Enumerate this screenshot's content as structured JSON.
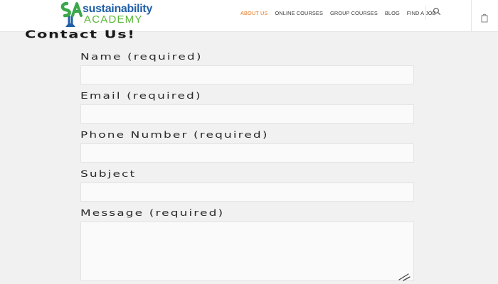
{
  "header": {
    "logo": {
      "line1": "sustainability",
      "line2": "ACADEMY",
      "colors": {
        "blue": "#1f5fa8",
        "green": "#5cb83a",
        "mark_green": "#3aa84a"
      }
    },
    "nav": {
      "items": [
        {
          "label": "ABOUT US",
          "active": true
        },
        {
          "label": "ONLINE COURSES",
          "active": false
        },
        {
          "label": "GROUP COURSES",
          "active": false
        },
        {
          "label": "BLOG",
          "active": false
        },
        {
          "label": "FIND A JOB",
          "active": false
        }
      ],
      "active_color": "#e8751a",
      "search_icon": "search-icon",
      "cart_icon": "cart-icon"
    }
  },
  "form": {
    "title": "Contact Us!",
    "fields": [
      {
        "label": "Name (required)",
        "value": ""
      },
      {
        "label": "Email (required)",
        "value": ""
      },
      {
        "label": "Phone Number (required)",
        "value": ""
      },
      {
        "label": "Subject",
        "value": ""
      },
      {
        "label": "Message (required)",
        "value": ""
      }
    ]
  }
}
